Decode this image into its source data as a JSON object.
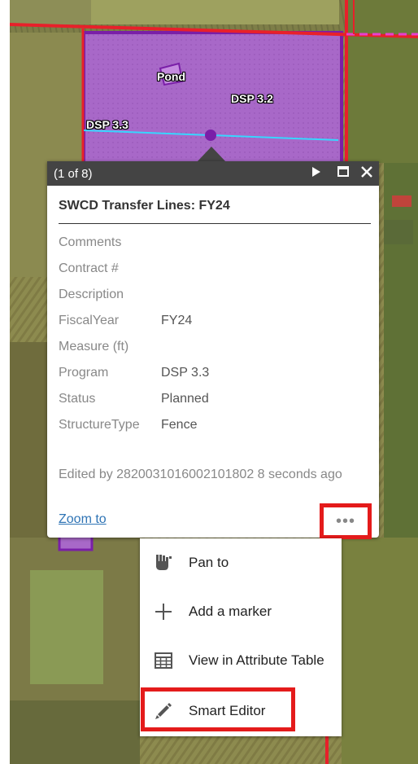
{
  "map": {
    "labels": {
      "pond": "Pond",
      "dsp32": "DSP 3.2",
      "dsp33": "DSP 3.3"
    },
    "colors": {
      "parcel_fill": "#a766c9",
      "parcel_border": "#7a1fa8",
      "boundary_line": "#e8202a",
      "transfer_line": "#38d6ff",
      "ground": "#8a8a4a"
    }
  },
  "popup": {
    "counter": "(1 of 8)",
    "next_icon": "play-icon",
    "maximize_icon": "maximize-icon",
    "close_icon": "close-icon",
    "title": "SWCD Transfer Lines: FY24",
    "attributes": [
      {
        "key": "Comments",
        "value": ""
      },
      {
        "key": "Contract #",
        "value": ""
      },
      {
        "key": "Description",
        "value": ""
      },
      {
        "key": "FiscalYear",
        "value": "FY24"
      },
      {
        "key": "Measure (ft)",
        "value": ""
      },
      {
        "key": "Program",
        "value": "DSP 3.3"
      },
      {
        "key": "Status",
        "value": "Planned"
      },
      {
        "key": "StructureType",
        "value": "Fence"
      }
    ],
    "edited_text": "Edited by 2820031016002101802 8 seconds ago",
    "zoom_label": "Zoom to",
    "more_label": "•••",
    "header_color": "#444444",
    "highlight_color": "#e41b1b"
  },
  "menu": {
    "items": [
      {
        "label": "Pan to",
        "icon": "pan-icon"
      },
      {
        "label": "Add a marker",
        "icon": "plus-icon"
      },
      {
        "label": "View in Attribute Table",
        "icon": "table-icon"
      },
      {
        "label": "Smart Editor",
        "icon": "pencil-icon"
      }
    ]
  }
}
